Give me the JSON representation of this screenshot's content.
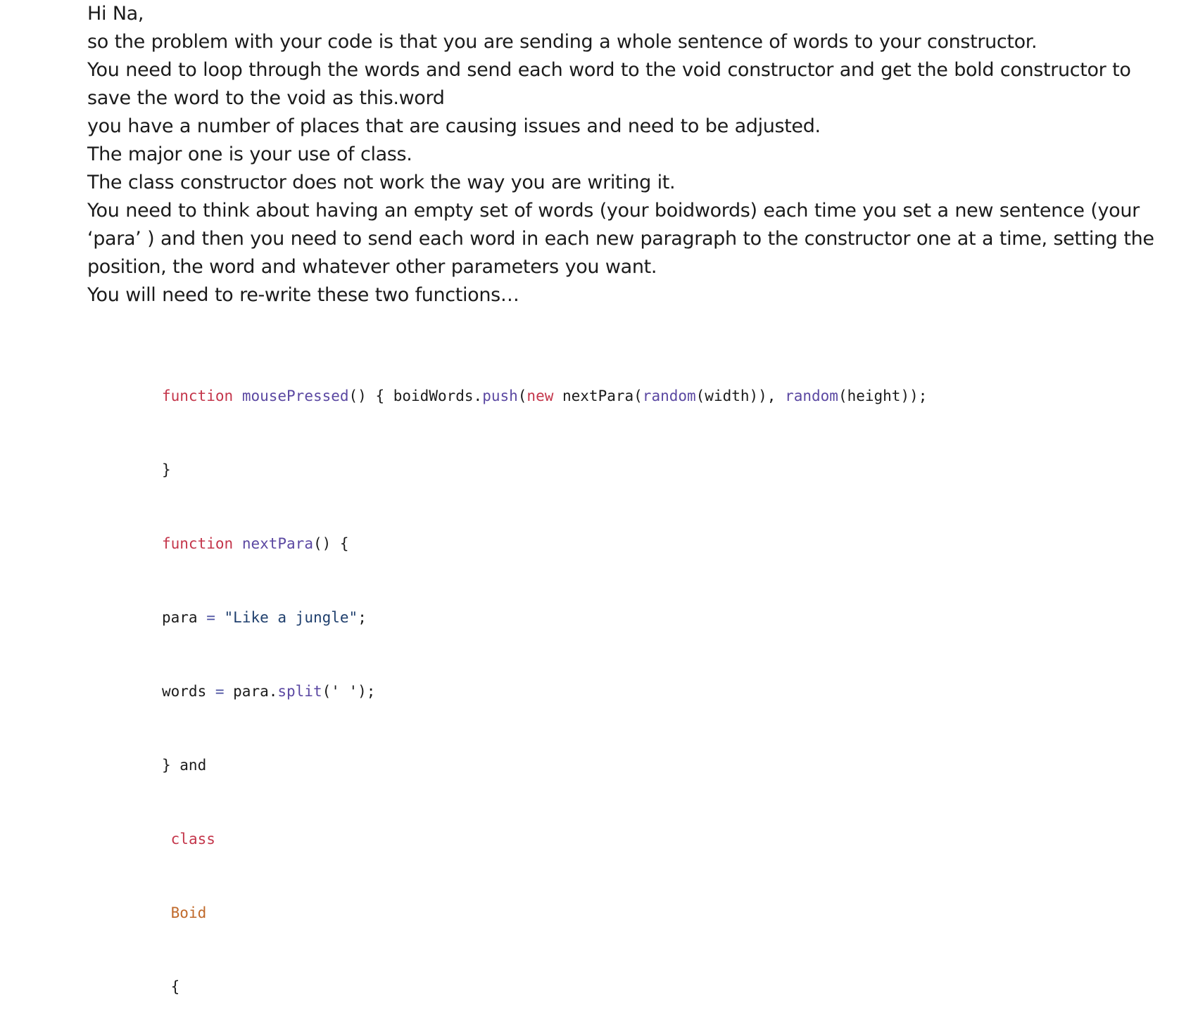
{
  "post": {
    "paragraphs": [
      "Hi Na,",
      "so the problem with your code is that you are sending a whole sentence of words to your constructor.",
      "You need to loop through the words and send each word to the void constructor and get the bold constructor to save the word to the void as this.word",
      "you have a number of places that are causing issues and need to be adjusted.",
      "The major one is your use of class.",
      "The class constructor does not work the way you are writing it.",
      "You need to think about having an empty set of words (your boidwords) each time you set a new sentence (your ‘para’ ) and then you need to send each word in each new paragraph to the constructor one at a time, setting the position, the word and whatever other parameters you want.",
      "You will need to re-write these two functions…"
    ]
  },
  "code": {
    "line1": {
      "kw_function": "function",
      "fn_name": "mousePressed",
      "t1": "() { boidWords.",
      "fn_push": "push",
      "t2": "(",
      "kw_new": "new",
      "t3": " nextPara(",
      "fn_random1": "random",
      "t4": "(width)), ",
      "fn_random2": "random",
      "t5": "(height));"
    },
    "line2": "}",
    "line3": {
      "kw_function": "function",
      "fn_name": "nextPara",
      "t1": "() {"
    },
    "line4": {
      "t1": "para ",
      "op": "=",
      "t2": " ",
      "str": "\"Like a jungle\"",
      "t3": ";"
    },
    "line5": {
      "t1": "words ",
      "op": "=",
      "t2": " para.",
      "fn_split": "split",
      "t3": "(' ');"
    },
    "line6": "} and",
    "line7": "class",
    "line8": "Boid",
    "line9": "{"
  },
  "colors": {
    "keyword": "#c4364b",
    "function_name": "#5b48a2",
    "string": "#1f3f6d",
    "class_name": "#c0692a",
    "text": "#1b1b1b"
  }
}
